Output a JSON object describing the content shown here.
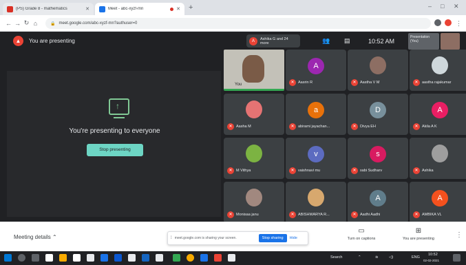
{
  "browser": {
    "tabs": [
      {
        "title": "(PS) Grade 8 - mathematics",
        "color": "#d93025"
      },
      {
        "title": "Meet - abc-xyzf-mn",
        "color": "#1a73e8"
      }
    ],
    "url": "meet.google.com/abc-xyzf-mn?authuser=0"
  },
  "presenting_bar": {
    "title": "You are presenting",
    "notification": {
      "initial": "A",
      "text": "Ashika G and 24 more"
    },
    "clock": "10:52 AM",
    "self_label": "Presentation (You)"
  },
  "presentation": {
    "message": "You're presenting to everyone",
    "stop_button": "Stop presenting"
  },
  "self_tile": {
    "name": "You"
  },
  "participants": [
    {
      "name": "Aasrin R",
      "initial": "A",
      "color": "#9c27b0",
      "photo": false
    },
    {
      "name": "Aastha V M",
      "initial": "",
      "color": "#8d6e63",
      "photo": true
    },
    {
      "name": "aastha rajakumar",
      "initial": "",
      "color": "#cfd8dc",
      "photo": true
    },
    {
      "name": "Aasha M",
      "initial": "",
      "color": "#e57373",
      "photo": true
    },
    {
      "name": "abirami jayachan...",
      "initial": "a",
      "color": "#e8710a",
      "photo": false
    },
    {
      "name": "Divya EH",
      "initial": "D",
      "color": "#78909c",
      "photo": false
    },
    {
      "name": "Akila A K",
      "initial": "A",
      "color": "#e91e63",
      "photo": false
    },
    {
      "name": "M Vithya",
      "initial": "",
      "color": "#7cb342",
      "photo": true
    },
    {
      "name": "vaishnavi mu",
      "initial": "v",
      "color": "#5c6bc0",
      "photo": false
    },
    {
      "name": "sabi Sudharv",
      "initial": "s",
      "color": "#d81b60",
      "photo": false
    },
    {
      "name": "Ashika",
      "initial": "",
      "color": "#9e9e9e",
      "photo": true
    },
    {
      "name": "Monisaa janu",
      "initial": "",
      "color": "#a1887f",
      "photo": true
    },
    {
      "name": "ABISHWARYA R...",
      "initial": "",
      "color": "#d7a86e",
      "photo": true
    },
    {
      "name": "Aadhi Aadhi",
      "initial": "A",
      "color": "#607d8b",
      "photo": false
    },
    {
      "name": "AMBIKA VL",
      "initial": "A",
      "color": "#f4511e",
      "photo": false
    }
  ],
  "bottom_bar": {
    "meeting_details": "Meeting details",
    "share_message": "meet.google.com is sharing your screen.",
    "stop_sharing": "Stop sharing",
    "hide": "Hide",
    "captions": "Turn on captions",
    "presenting": "You are presenting"
  },
  "taskbar": {
    "search": "Search",
    "lang": "ENG",
    "time": "10:52",
    "date": "02-02-2021"
  }
}
